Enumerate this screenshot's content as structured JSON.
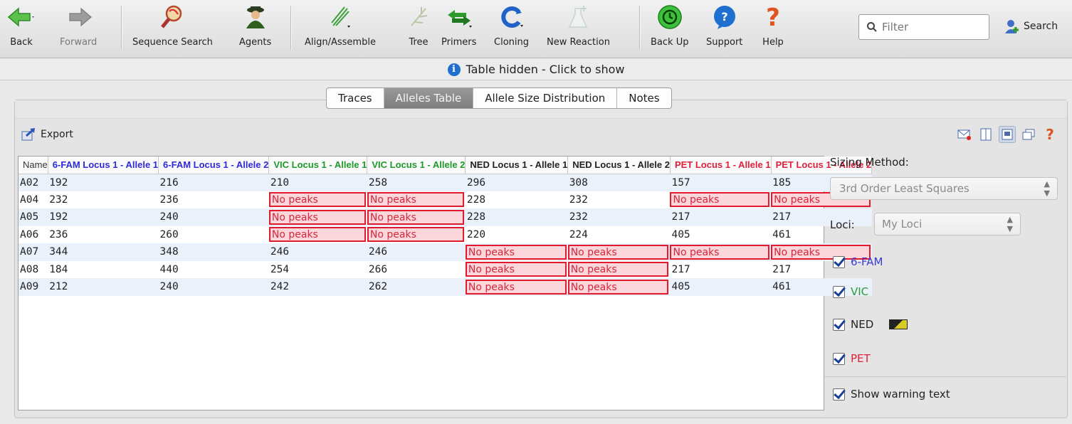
{
  "toolbar": {
    "back": "Back",
    "forward": "Forward",
    "sequence_search": "Sequence Search",
    "agents": "Agents",
    "align_assemble": "Align/Assemble",
    "tree": "Tree",
    "primers": "Primers",
    "cloning": "Cloning",
    "new_reaction": "New Reaction",
    "back_up": "Back Up",
    "support": "Support",
    "help": "Help",
    "filter_placeholder": "Filter",
    "search": "Search"
  },
  "banner": {
    "text": "Table hidden - Click to show"
  },
  "tabs": [
    "Traces",
    "Alleles Table",
    "Allele Size Distribution",
    "Notes"
  ],
  "active_tab": "Alleles Table",
  "export_label": "Export",
  "colors": {
    "fam": "#2d2ad6",
    "vic": "#1d9a2a",
    "ned": "#222222",
    "pet": "#e0203b"
  },
  "table": {
    "columns": [
      {
        "label": "Name",
        "dye": "name"
      },
      {
        "label": "6-FAM Locus 1 - Allele 1",
        "dye": "fam"
      },
      {
        "label": "6-FAM Locus 1 - Allele 2",
        "dye": "fam"
      },
      {
        "label": "VIC Locus 1 - Allele 1",
        "dye": "vic"
      },
      {
        "label": "VIC Locus 1 - Allele 2",
        "dye": "vic"
      },
      {
        "label": "NED Locus 1 - Allele 1",
        "dye": "ned"
      },
      {
        "label": "NED Locus 1 - Allele 2",
        "dye": "ned"
      },
      {
        "label": "PET Locus 1 - Allele 1",
        "dye": "pet"
      },
      {
        "label": "PET Locus 1 - Allele 2",
        "dye": "pet"
      }
    ],
    "rows": [
      [
        "A02",
        "192",
        "216",
        "210",
        "258",
        "296",
        "308",
        "157",
        "185"
      ],
      [
        "A04",
        "232",
        "236",
        "No peaks",
        "No peaks",
        "228",
        "232",
        "No peaks",
        "No peaks"
      ],
      [
        "A05",
        "192",
        "240",
        "No peaks",
        "No peaks",
        "228",
        "232",
        "217",
        "217"
      ],
      [
        "A06",
        "236",
        "260",
        "No peaks",
        "No peaks",
        "220",
        "224",
        "405",
        "461"
      ],
      [
        "A07",
        "344",
        "348",
        "246",
        "246",
        "No peaks",
        "No peaks",
        "No peaks",
        "No peaks"
      ],
      [
        "A08",
        "184",
        "440",
        "254",
        "266",
        "No peaks",
        "No peaks",
        "217",
        "217"
      ],
      [
        "A09",
        "212",
        "240",
        "242",
        "262",
        "No peaks",
        "No peaks",
        "405",
        "461"
      ]
    ]
  },
  "side": {
    "sizing_label": "Sizing Method:",
    "sizing_value": "3rd Order Least Squares",
    "loci_label": "Loci:",
    "loci_value": "My Loci",
    "dyes": [
      {
        "label": "6-FAM",
        "color": "#3a3ad8"
      },
      {
        "label": "VIC",
        "color": "#2a9a35"
      },
      {
        "label": "NED",
        "color": "#222222"
      },
      {
        "label": "PET",
        "color": "#e0203b"
      }
    ],
    "show_warning": "Show warning text"
  }
}
